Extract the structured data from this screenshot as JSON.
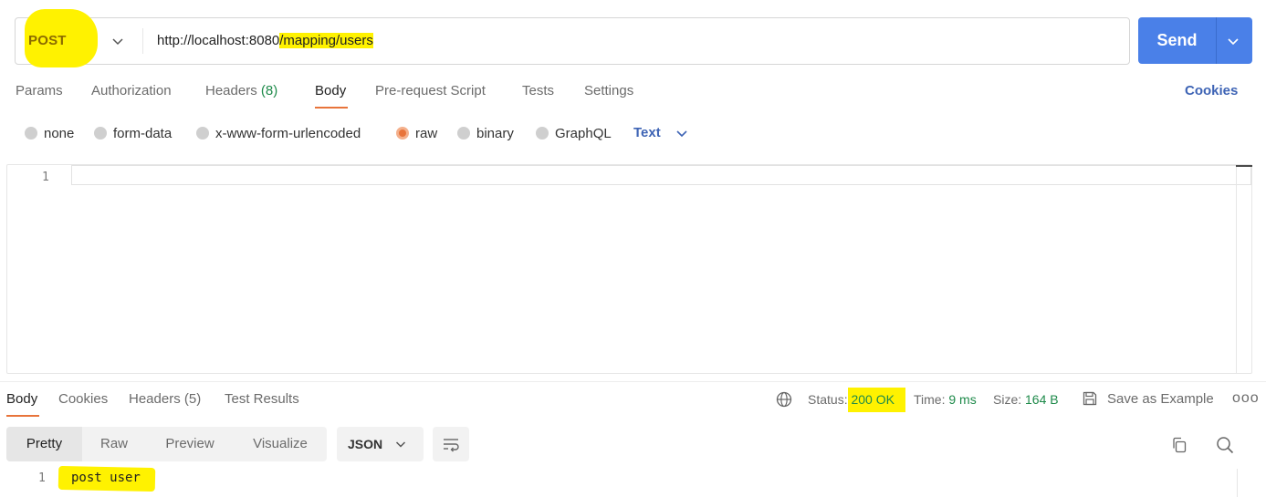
{
  "request": {
    "method": "POST",
    "url_prefix": "http://localhost:8080",
    "url_path": "/mapping/users",
    "send_label": "Send"
  },
  "request_tabs": {
    "params": "Params",
    "authorization": "Authorization",
    "headers": "Headers",
    "headers_count": "(8)",
    "body": "Body",
    "prerequest": "Pre-request Script",
    "tests": "Tests",
    "settings": "Settings",
    "cookies": "Cookies"
  },
  "body_types": {
    "none": "none",
    "form_data": "form-data",
    "urlencoded": "x-www-form-urlencoded",
    "raw": "raw",
    "binary": "binary",
    "graphql": "GraphQL",
    "raw_format": "Text",
    "selected": "raw"
  },
  "editor": {
    "line_number": "1"
  },
  "response_tabs": {
    "body": "Body",
    "cookies": "Cookies",
    "headers": "Headers",
    "headers_count": "(5)",
    "test_results": "Test Results"
  },
  "response_meta": {
    "status_label": "Status:",
    "status_value": "200 OK",
    "time_label": "Time:",
    "time_value": "9 ms",
    "size_label": "Size:",
    "size_value": "164 B",
    "save_example": "Save as Example",
    "more": "ooo"
  },
  "response_view": {
    "pretty": "Pretty",
    "raw": "Raw",
    "preview": "Preview",
    "visualize": "Visualize",
    "format": "JSON"
  },
  "response_body": {
    "line_number": "1",
    "text": "post user"
  },
  "colors": {
    "send": "#4a80e8",
    "accent": "#e8743b",
    "highlight": "#fff200",
    "status_ok": "#1e8a4a",
    "link": "#3e64b5"
  }
}
